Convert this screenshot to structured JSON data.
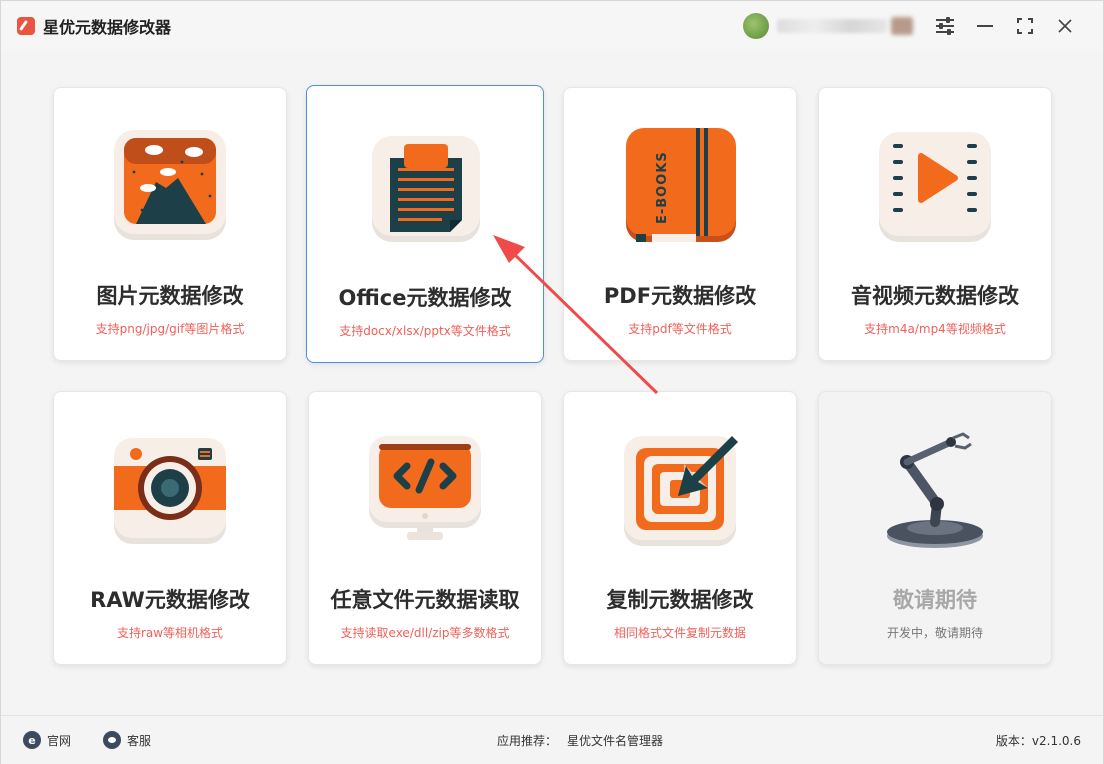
{
  "app": {
    "title": "星优元数据修改器"
  },
  "cards": [
    {
      "id": "image",
      "title": "图片元数据修改",
      "subtitle": "支持png/jpg/gif等图片格式"
    },
    {
      "id": "office",
      "title": "Office元数据修改",
      "subtitle": "支持docx/xlsx/pptx等文件格式"
    },
    {
      "id": "pdf",
      "title": "PDF元数据修改",
      "subtitle": "支持pdf等文件格式"
    },
    {
      "id": "av",
      "title": "音视频元数据修改",
      "subtitle": "支持m4a/mp4等视频格式"
    },
    {
      "id": "raw",
      "title": "RAW元数据修改",
      "subtitle": "支持raw等相机格式"
    },
    {
      "id": "any",
      "title": "任意文件元数据读取",
      "subtitle": "支持读取exe/dll/zip等多数格式"
    },
    {
      "id": "copy",
      "title": "复制元数据修改",
      "subtitle": "相同格式文件复制元数据"
    },
    {
      "id": "soon",
      "title": "敬请期待",
      "subtitle": "开发中，敬请期待"
    }
  ],
  "footer": {
    "website": "官网",
    "support": "客服",
    "recommend_label": "应用推荐：",
    "recommend_app": "星优文件名管理器",
    "version": "版本：v2.1.0.6"
  },
  "icons": {
    "pdf_book_text": "E-BOOKS"
  },
  "colors": {
    "accent": "#f26a1b",
    "dark_teal": "#1d3f48",
    "subtitle_red": "#f0605a",
    "active_border": "#4a8ee8",
    "arrow_red": "#f04a4a"
  }
}
